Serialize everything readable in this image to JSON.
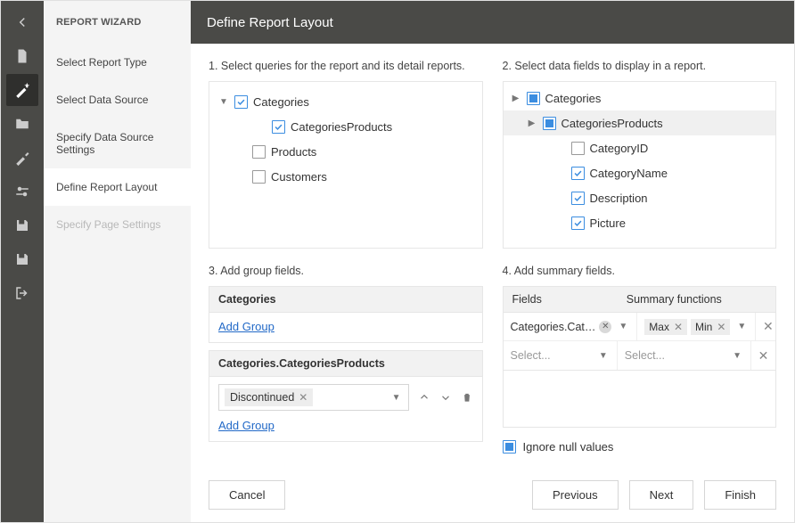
{
  "sidebar_title": "REPORT WIZARD",
  "page_title": "Define Report Layout",
  "steps": [
    {
      "label": "Select Report Type",
      "state": "normal"
    },
    {
      "label": "Select Data Source",
      "state": "normal"
    },
    {
      "label": "Specify Data Source Settings",
      "state": "normal"
    },
    {
      "label": "Define Report Layout",
      "state": "active"
    },
    {
      "label": "Specify Page Settings",
      "state": "disabled"
    }
  ],
  "section1": {
    "title": "1. Select queries for the report and its detail reports.",
    "items": [
      {
        "label": "Categories",
        "checked": true,
        "expander": "down",
        "indent": 0
      },
      {
        "label": "CategoriesProducts",
        "checked": true,
        "expander": "",
        "indent": 2
      },
      {
        "label": "Products",
        "checked": false,
        "expander": "",
        "indent": 1
      },
      {
        "label": "Customers",
        "checked": false,
        "expander": "",
        "indent": 1
      }
    ]
  },
  "section2": {
    "title": "2. Select data fields to display in a report.",
    "items": [
      {
        "label": "Categories",
        "style": "sq",
        "expander": "right",
        "indent": 0,
        "sel": false
      },
      {
        "label": "CategoriesProducts",
        "style": "sq",
        "expander": "right",
        "indent": 1,
        "sel": true
      },
      {
        "label": "CategoryID",
        "style": "empty",
        "expander": "",
        "indent": 3,
        "sel": false
      },
      {
        "label": "CategoryName",
        "style": "checked",
        "expander": "",
        "indent": 3,
        "sel": false
      },
      {
        "label": "Description",
        "style": "checked",
        "expander": "",
        "indent": 3,
        "sel": false
      },
      {
        "label": "Picture",
        "style": "checked",
        "expander": "",
        "indent": 3,
        "sel": false
      }
    ]
  },
  "section3": {
    "title": "3. Add group fields.",
    "groups": [
      {
        "header": "Categories",
        "add_label": "Add Group",
        "chip": ""
      },
      {
        "header": "Categories.CategoriesProducts",
        "add_label": "Add Group",
        "chip": "Discontinued"
      }
    ]
  },
  "section4": {
    "title": "4. Add summary fields.",
    "col_fields": "Fields",
    "col_funcs": "Summary functions",
    "rows": [
      {
        "field": "Categories.Cat…",
        "has_clear": true,
        "funcs": [
          "Max",
          "Min"
        ],
        "placeholder": ""
      },
      {
        "field": "",
        "has_clear": false,
        "funcs": [],
        "placeholder": "Select..."
      }
    ],
    "ignore_label": "Ignore null values",
    "ignore_checked": true
  },
  "buttons": {
    "cancel": "Cancel",
    "previous": "Previous",
    "next": "Next",
    "finish": "Finish"
  }
}
